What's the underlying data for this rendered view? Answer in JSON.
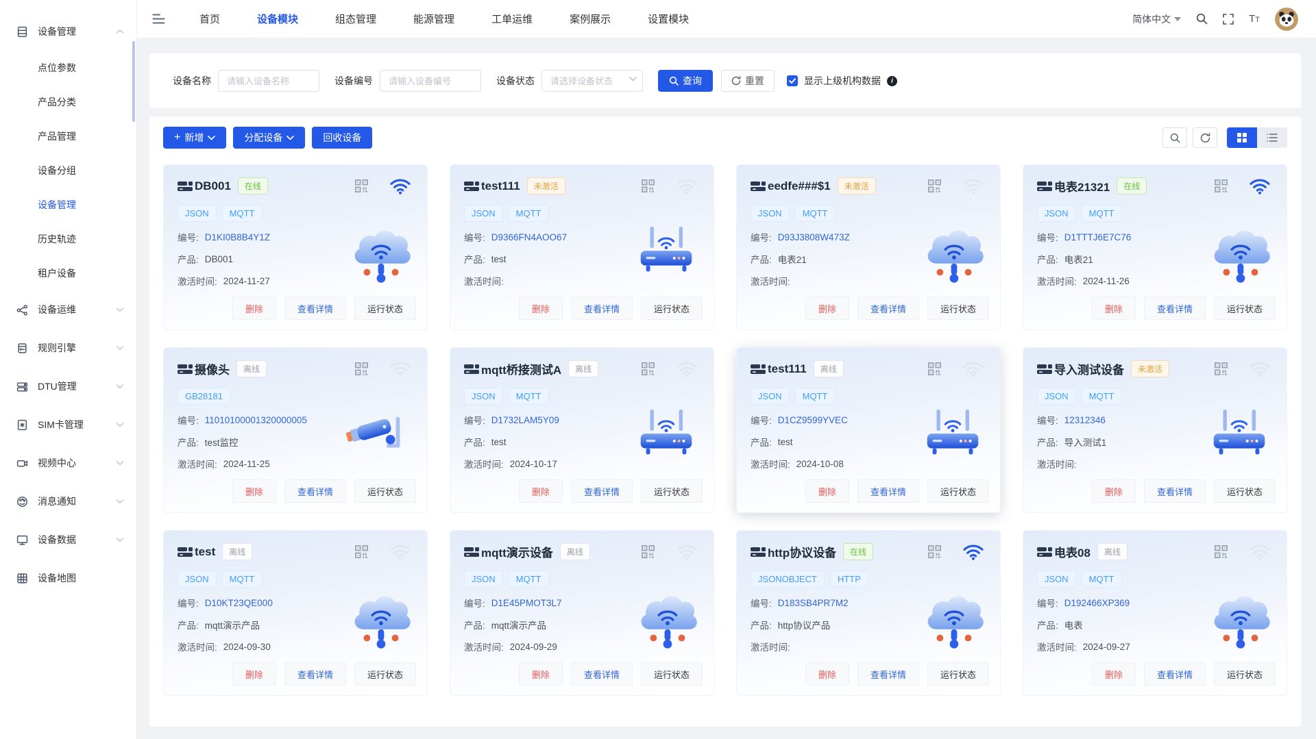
{
  "colors": {
    "primary": "#2458e6",
    "link": "#3166d8",
    "tag": "#409eff",
    "online": "#67c23a",
    "inactive": "#e6a23c",
    "offline": "#9ba1a9",
    "danger": "#f05a5a",
    "bg": "#f0f2f5"
  },
  "header": {
    "nav": [
      {
        "label": "首页",
        "active": false
      },
      {
        "label": "设备模块",
        "active": true
      },
      {
        "label": "组态管理",
        "active": false
      },
      {
        "label": "能源管理",
        "active": false
      },
      {
        "label": "工单运维",
        "active": false
      },
      {
        "label": "案例展示",
        "active": false
      },
      {
        "label": "设置模块",
        "active": false
      }
    ],
    "language": "简体中文"
  },
  "sidebar": {
    "items": [
      {
        "label": "设备管理",
        "icon": "device",
        "expanded": true,
        "children": [
          {
            "label": "点位参数",
            "active": false
          },
          {
            "label": "产品分类",
            "active": false
          },
          {
            "label": "产品管理",
            "active": false
          },
          {
            "label": "设备分组",
            "active": false
          },
          {
            "label": "设备管理",
            "active": true
          },
          {
            "label": "历史轨迹",
            "active": false
          },
          {
            "label": "租户设备",
            "active": false
          }
        ]
      },
      {
        "label": "设备运维",
        "icon": "ops",
        "collapsible": true
      },
      {
        "label": "规则引擎",
        "icon": "rule",
        "collapsible": true
      },
      {
        "label": "DTU管理",
        "icon": "dtu",
        "collapsible": true
      },
      {
        "label": "SIM卡管理",
        "icon": "sim",
        "collapsible": true
      },
      {
        "label": "视频中心",
        "icon": "video",
        "collapsible": true
      },
      {
        "label": "消息通知",
        "icon": "message",
        "collapsible": true
      },
      {
        "label": "设备数据",
        "icon": "data",
        "collapsible": true
      },
      {
        "label": "设备地图",
        "icon": "map",
        "collapsible": false
      }
    ]
  },
  "filters": {
    "name_label": "设备名称",
    "name_placeholder": "请输入设备名称",
    "code_label": "设备编号",
    "code_placeholder": "请输入设备编号",
    "status_label": "设备状态",
    "status_placeholder": "请选择设备状态",
    "search_button": "查询",
    "reset_button": "重置",
    "show_parent_label": "显示上级机构数据",
    "show_parent_checked": true
  },
  "toolbar": {
    "add": "新增",
    "assign": "分配设备",
    "recycle": "回收设备"
  },
  "card_labels": {
    "code": "编号:",
    "product": "产品:",
    "activated": "激活时间:"
  },
  "card_actions": {
    "delete": "删除",
    "detail": "查看详情",
    "status": "运行状态"
  },
  "cards": [
    {
      "name": "DB001",
      "status": "在线",
      "statusType": "online",
      "tags": [
        "JSON",
        "MQTT"
      ],
      "code": "D1KI0B8B4Y1Z",
      "product": "DB001",
      "activated": "2024-11-27",
      "image": "cloud",
      "wifi": true,
      "highlighted": false
    },
    {
      "name": "test111",
      "status": "未激活",
      "statusType": "inactive",
      "tags": [
        "JSON",
        "MQTT"
      ],
      "code": "D9366FN4AOO67",
      "product": "test",
      "activated": "",
      "image": "router",
      "wifi": false,
      "highlighted": false
    },
    {
      "name": "eedfe###$1",
      "status": "未激活",
      "statusType": "inactive",
      "tags": [
        "JSON",
        "MQTT"
      ],
      "code": "D93J3808W473Z",
      "product": "电表21",
      "activated": "",
      "image": "cloud",
      "wifi": false,
      "highlighted": false
    },
    {
      "name": "电表21321",
      "status": "在线",
      "statusType": "online",
      "tags": [
        "JSON",
        "MQTT"
      ],
      "code": "D1TTTJ6E7C76",
      "product": "电表21",
      "activated": "2024-11-26",
      "image": "cloud",
      "wifi": true,
      "highlighted": false
    },
    {
      "name": "摄像头",
      "status": "离线",
      "statusType": "offline",
      "tags": [
        "GB28181"
      ],
      "code": "11010100001320000005",
      "product": "test监控",
      "activated": "2024-11-25",
      "image": "camera",
      "wifi": false,
      "highlighted": false
    },
    {
      "name": "mqtt桥接测试A",
      "status": "离线",
      "statusType": "offline",
      "tags": [
        "JSON",
        "MQTT"
      ],
      "code": "D1732LAM5Y09",
      "product": "test",
      "activated": "2024-10-17",
      "image": "router",
      "wifi": false,
      "highlighted": false
    },
    {
      "name": "test111",
      "status": "离线",
      "statusType": "offline",
      "tags": [
        "JSON",
        "MQTT"
      ],
      "code": "D1CZ9599YVEC",
      "product": "test",
      "activated": "2024-10-08",
      "image": "router",
      "wifi": false,
      "highlighted": true
    },
    {
      "name": "导入测试设备",
      "status": "未激活",
      "statusType": "inactive",
      "tags": [
        "JSON",
        "MQTT"
      ],
      "code": "12312346",
      "product": "导入测试1",
      "activated": "",
      "image": "router",
      "wifi": false,
      "highlighted": false
    },
    {
      "name": "test",
      "status": "离线",
      "statusType": "offline",
      "tags": [
        "JSON",
        "MQTT"
      ],
      "code": "D10KT23QE000",
      "product": "mqtt演示产品",
      "activated": "2024-09-30",
      "image": "cloud",
      "wifi": false,
      "highlighted": false
    },
    {
      "name": "mqtt演示设备",
      "status": "离线",
      "statusType": "offline",
      "tags": [
        "JSON",
        "MQTT"
      ],
      "code": "D1E45PMOT3L7",
      "product": "mqtt演示产品",
      "activated": "2024-09-29",
      "image": "cloud",
      "wifi": false,
      "highlighted": false
    },
    {
      "name": "http协议设备",
      "status": "在线",
      "statusType": "online",
      "tags": [
        "JSONOBJECT",
        "HTTP"
      ],
      "code": "D183SB4PR7M2",
      "product": "http协议产品",
      "activated": "",
      "image": "cloud",
      "wifi": true,
      "highlighted": false
    },
    {
      "name": "电表08",
      "status": "离线",
      "statusType": "offline",
      "tags": [
        "JSON",
        "MQTT"
      ],
      "code": "D192466XP369",
      "product": "电表",
      "activated": "2024-09-27",
      "image": "cloud",
      "wifi": false,
      "highlighted": false
    }
  ]
}
